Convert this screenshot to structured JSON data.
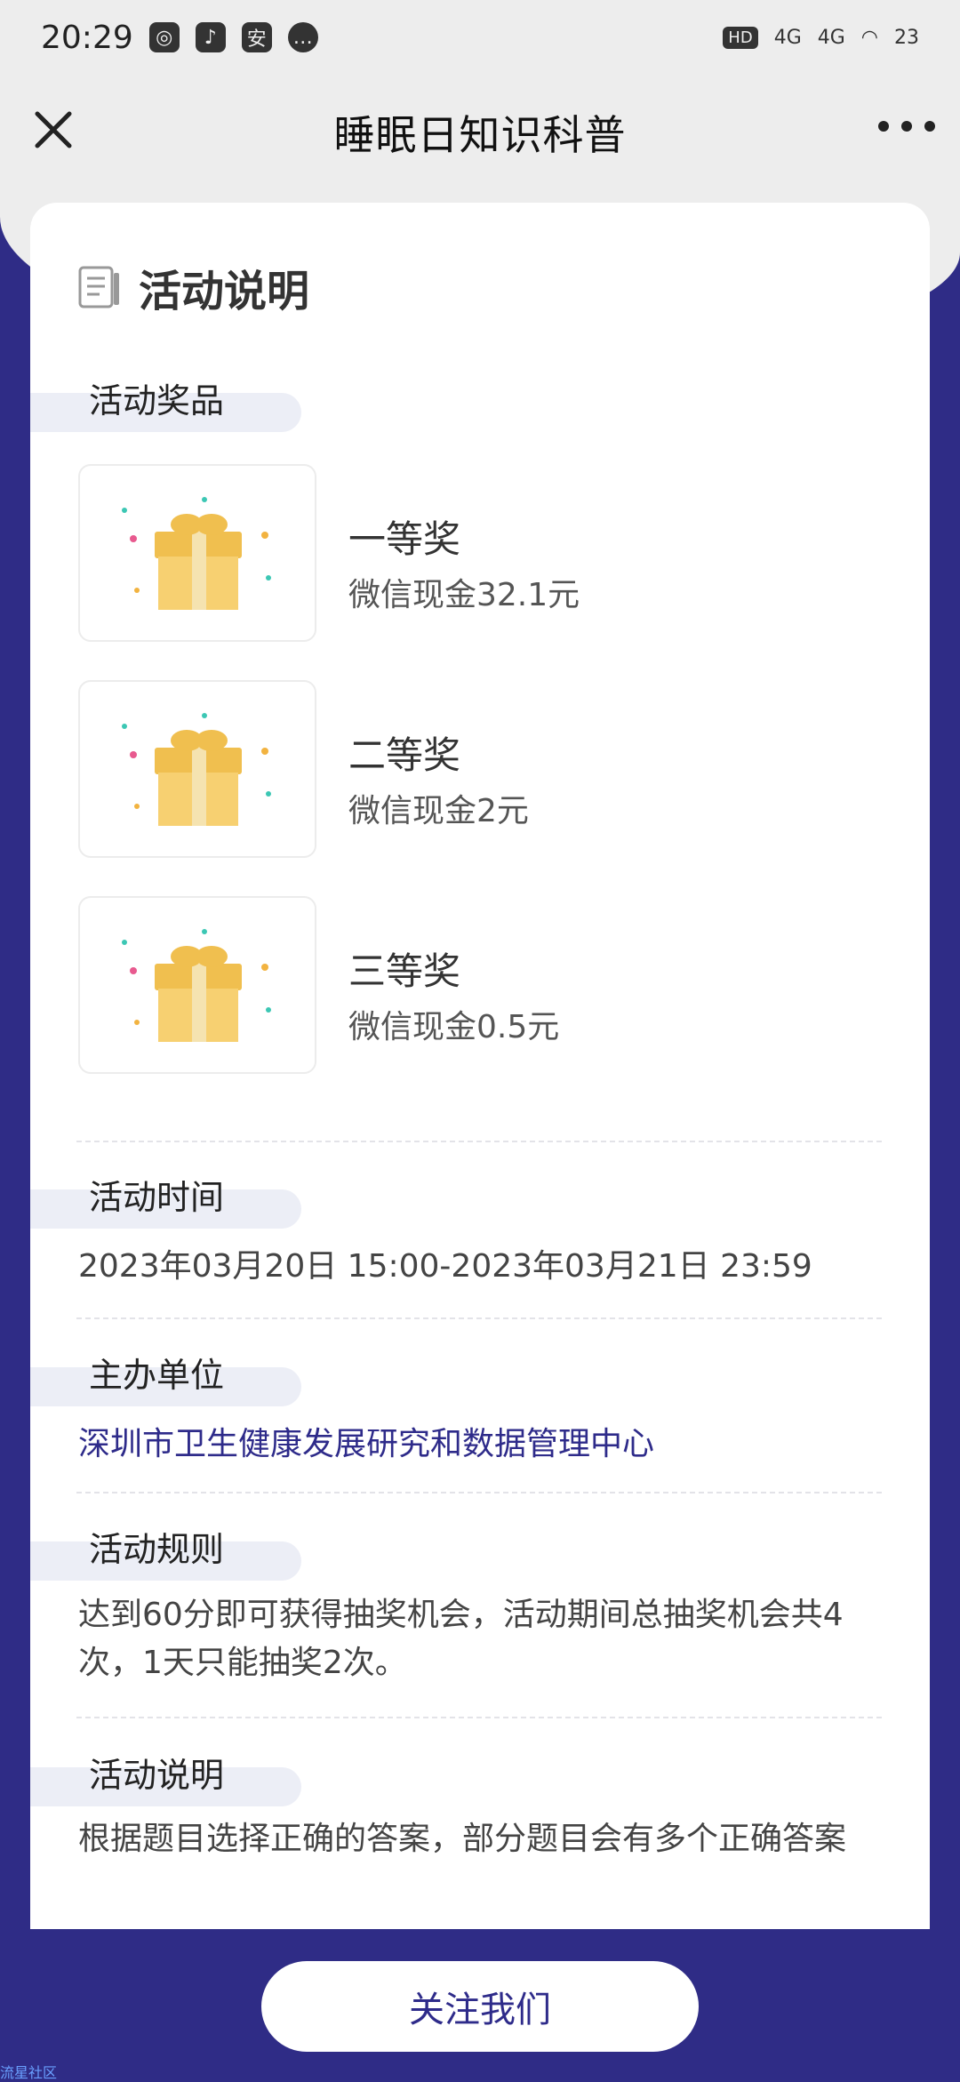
{
  "status_bar": {
    "time": "20:29",
    "hd_label": "HD",
    "net1": "4G",
    "net2": "4G",
    "battery": "23"
  },
  "nav": {
    "title": "睡眠日知识科普"
  },
  "section": {
    "title": "活动说明"
  },
  "prizes_label": "活动奖品",
  "prizes": [
    {
      "name": "一等奖",
      "desc": "微信现金32.1元"
    },
    {
      "name": "二等奖",
      "desc": "微信现金2元"
    },
    {
      "name": "三等奖",
      "desc": "微信现金0.5元"
    }
  ],
  "time_label": "活动时间",
  "time_value": "2023年03月20日 15:00-2023年03月21日 23:59",
  "organizer_label": "主办单位",
  "organizer_value": "深圳市卫生健康发展研究和数据管理中心",
  "rules_label": "活动规则",
  "rules_value": "达到60分即可获得抽奖机会，活动期间总抽奖机会共4次，1天只能抽奖2次。",
  "desc_label": "活动说明",
  "desc_value": "根据题目选择正确的答案，部分题目会有多个正确答案",
  "follow_button": "关注我们",
  "watermark": "流星社区",
  "colors": {
    "brand": "#2f2c86",
    "link": "#2e2b8a",
    "pill": "#eceef6",
    "gift": "#f3c65a"
  }
}
